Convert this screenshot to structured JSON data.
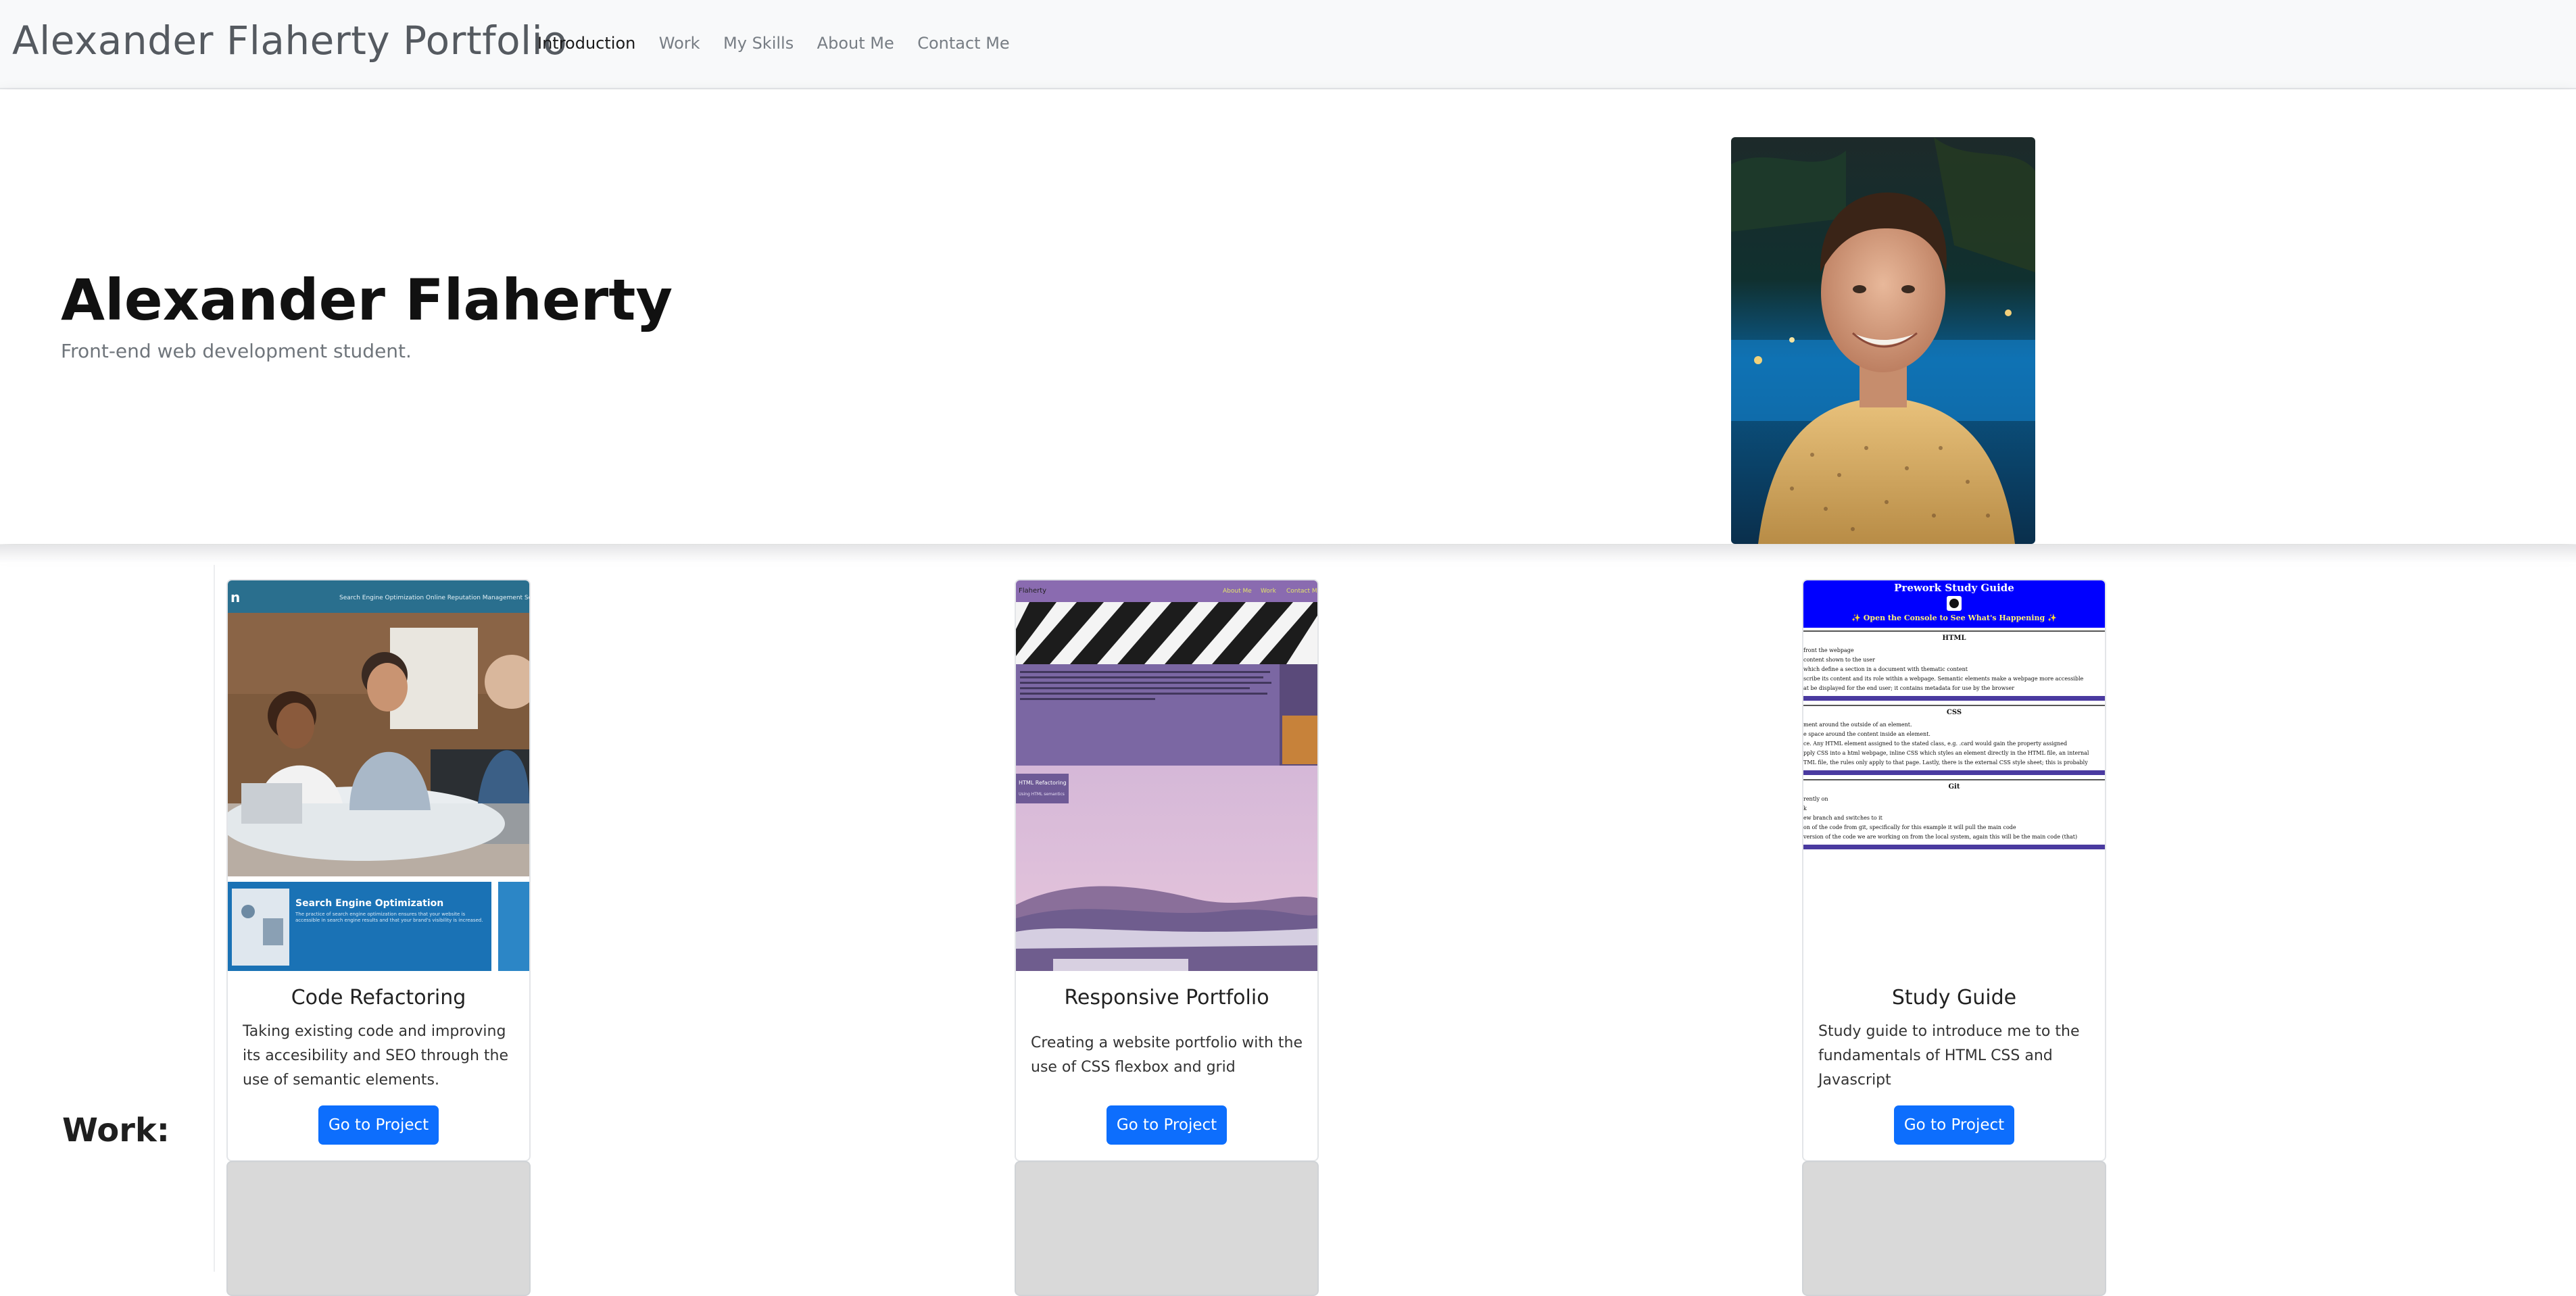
{
  "nav": {
    "brand": "Alexander Flaherty Portfolio",
    "links": [
      {
        "label": "Introduction",
        "active": true
      },
      {
        "label": "Work"
      },
      {
        "label": "My Skills"
      },
      {
        "label": "About Me"
      },
      {
        "label": "Contact Me"
      }
    ]
  },
  "hero": {
    "name": "Alexander Flaherty",
    "subtitle": "Front-end web development student."
  },
  "work": {
    "heading": "Work:",
    "projects": [
      {
        "title": "Code Refactoring",
        "description": "Taking existing code and improving its accesibility and SEO through the use of semantic elements.",
        "button": "Go to Project",
        "thumb": {
          "nav_items": "Search Engine Optimization    Online Reputation Management    Socia",
          "card_title": "Search Engine Optimization",
          "card_text": "The practice of search engine optimization ensures that your website is accessible in search engine results and that your brand's visibility is increased."
        }
      },
      {
        "title": "Responsive Portfolio",
        "description": "Creating a website portfolio with the use of CSS flexbox and grid",
        "button": "Go to Project",
        "thumb": {
          "brand": "Flaherty",
          "nav_items": [
            "About Me",
            "Work",
            "Contact Me"
          ],
          "label": "HTML Refactoring",
          "sublabel": "Using HTML semantics"
        }
      },
      {
        "title": "Study Guide",
        "description": "Study guide to introduce me to the fundamentals of HTML CSS and Javascript",
        "button": "Go to Project",
        "thumb": {
          "title": "Prework Study Guide",
          "console_note": "✨ Open the Console to See What's Happening ✨",
          "sections": [
            {
              "heading": "HTML",
              "lines": [
                "front the webpage",
                "content shown to the user",
                "which define a section in a document with thematic content",
                "scribe its content and its role within a webpage. Semantic elements make a webpage more accessible",
                "at be displayed for the end user; it contains metadata for use by the browser"
              ]
            },
            {
              "heading": "CSS",
              "lines": [
                "ment around the outside of an element.",
                "e space around the content inside an element.",
                "ce. Any HTML element assigned to the stated class, e.g. .card would gain the property assigned",
                "pply CSS into a html webpage, inline CSS which styles an element directly in the HTML file, an internal",
                "TML file, the rules only apply to that page. Lastly, there is the external CSS style sheet; this is probably"
              ]
            },
            {
              "heading": "Git",
              "lines": [
                "rently on",
                "k",
                "ew branch and switches to it",
                "on of the code from git, specifically for this example it will pull the main code",
                "version of the code we are working on from the local system, again this will be the main code (that)"
              ]
            }
          ]
        }
      }
    ]
  }
}
